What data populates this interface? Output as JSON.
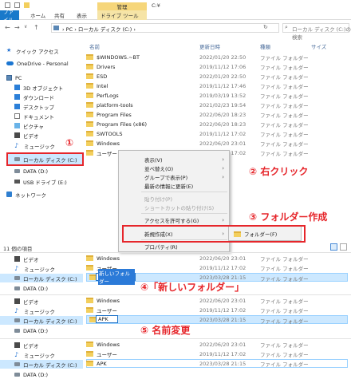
{
  "titlebar": {
    "manage": "管理",
    "title": "C:¥"
  },
  "ribbon_tabs": [
    "ファイル",
    "ホーム",
    "共有",
    "表示",
    "ドライブ ツール"
  ],
  "address": {
    "path": "›   PC  ›  ローカル ディスク (C:)  ›",
    "search_placeholder": "ローカル ディスク (C:)の検索"
  },
  "columns": {
    "name": "名前",
    "date": "更新日時",
    "type": "種類",
    "size": "サイズ"
  },
  "sidebar": [
    {
      "label": "クイック アクセス",
      "icon": "star-icon"
    },
    {
      "label": "OneDrive - Personal",
      "icon": "cloud-icon"
    },
    {
      "label": "PC",
      "icon": "pc-icon"
    },
    {
      "label": "3D オブジェクト",
      "icon": "cube-icon"
    },
    {
      "label": "ダウンロード",
      "icon": "download-icon"
    },
    {
      "label": "デスクトップ",
      "icon": "desktop-icon"
    },
    {
      "label": "ドキュメント",
      "icon": "document-icon"
    },
    {
      "label": "ピクチャ",
      "icon": "picture-icon"
    },
    {
      "label": "ビデオ",
      "icon": "video-icon"
    },
    {
      "label": "ミュージック",
      "icon": "music-icon"
    },
    {
      "label": "ローカル ディスク (C:)",
      "icon": "drive-icon"
    },
    {
      "label": "DATA (D:)",
      "icon": "drive-icon"
    },
    {
      "label": "USB ドライブ (E:)",
      "icon": "usb-icon"
    },
    {
      "label": "ネットワーク",
      "icon": "network-icon"
    }
  ],
  "files": [
    {
      "name": "$WINDOWS.~BT",
      "date": "2022/01/20 22:50",
      "type": "ファイル フォルダー"
    },
    {
      "name": "Drivers",
      "date": "2019/11/12 17:06",
      "type": "ファイル フォルダー"
    },
    {
      "name": "ESD",
      "date": "2022/01/20 22:50",
      "type": "ファイル フォルダー"
    },
    {
      "name": "Intel",
      "date": "2019/11/12 17:46",
      "type": "ファイル フォルダー"
    },
    {
      "name": "PerfLogs",
      "date": "2019/03/19 13:52",
      "type": "ファイル フォルダー"
    },
    {
      "name": "platform-tools",
      "date": "2021/02/23 19:54",
      "type": "ファイル フォルダー"
    },
    {
      "name": "Program Files",
      "date": "2022/06/20 18:23",
      "type": "ファイル フォルダー"
    },
    {
      "name": "Program Files (x86)",
      "date": "2022/06/20 18:23",
      "type": "ファイル フォルダー"
    },
    {
      "name": "SWTOOLS",
      "date": "2019/11/12 17:02",
      "type": "ファイル フォルダー"
    },
    {
      "name": "Windows",
      "date": "2022/06/20 23:01",
      "type": "ファイル フォルダー"
    },
    {
      "name": "ユーザー",
      "date": "2019/11/12 17:02",
      "type": "ファイル フォルダー"
    }
  ],
  "context_menu": [
    {
      "label": "表示(V)",
      "arrow": true,
      "disabled": false
    },
    {
      "label": "並べ替え(O)",
      "arrow": true,
      "disabled": false
    },
    {
      "label": "グループで表示(P)",
      "arrow": true,
      "disabled": false
    },
    {
      "label": "最新の情報に更新(E)",
      "arrow": false,
      "disabled": false
    },
    {
      "label": "貼り付け(P)",
      "arrow": false,
      "disabled": true
    },
    {
      "label": "ショートカットの貼り付け(S)",
      "arrow": false,
      "disabled": true
    },
    {
      "label": "アクセスを許可する(G)",
      "arrow": true,
      "disabled": false
    },
    {
      "label": "新規作成(X)",
      "arrow": true,
      "disabled": false
    },
    {
      "label": "プロパティ(R)",
      "arrow": false,
      "disabled": false
    }
  ],
  "submenu": {
    "label": "フォルダー(F)"
  },
  "status": {
    "count": "11 個の項目"
  },
  "annotations": {
    "a1": "①",
    "a2": "② 右クリック",
    "a3": "③ フォルダー作成",
    "a4": "④「新しいフォルダー」",
    "a5": "⑤ 名前変更"
  },
  "panels": {
    "p1": {
      "sidebar": [
        "ビデオ",
        "ミュージック",
        "ローカル ディスク (C:)",
        "DATA (D:)"
      ],
      "rows": [
        {
          "name": "Windows",
          "date": "2022/06/20 23:01",
          "type": "ファイル フォルダー"
        },
        {
          "name": "ユーザー",
          "date": "2019/11/12 17:02",
          "type": "ファイル フォルダー"
        }
      ],
      "new_name": "新しいフォルダー",
      "new_date": "2023/03/28 21:15",
      "new_type": "ファイル フォルダー"
    },
    "p2": {
      "sidebar": [
        "ビデオ",
        "ミュージック",
        "ローカル ディスク (C:)",
        "DATA (D:)"
      ],
      "rows": [
        {
          "name": "Windows",
          "date": "2022/06/20 23:01",
          "type": "ファイル フォルダー"
        },
        {
          "name": "ユーザー",
          "date": "2019/11/12 17:02",
          "type": "ファイル フォルダー"
        }
      ],
      "new_name": "APK",
      "new_date": "2023/03/28 21:15",
      "new_type": "ファイル フォルダー"
    },
    "p3": {
      "sidebar": [
        "ビデオ",
        "ミュージック",
        "ローカル ディスク (C:)",
        "DATA (D:)"
      ],
      "rows": [
        {
          "name": "Windows",
          "date": "2022/06/20 23:01",
          "type": "ファイル フォルダー"
        },
        {
          "name": "ユーザー",
          "date": "2019/11/12 17:02",
          "type": "ファイル フォルダー"
        }
      ],
      "new_name": "APK",
      "new_date": "2023/03/28 21:15",
      "new_type": "ファイル フォルダー"
    }
  }
}
